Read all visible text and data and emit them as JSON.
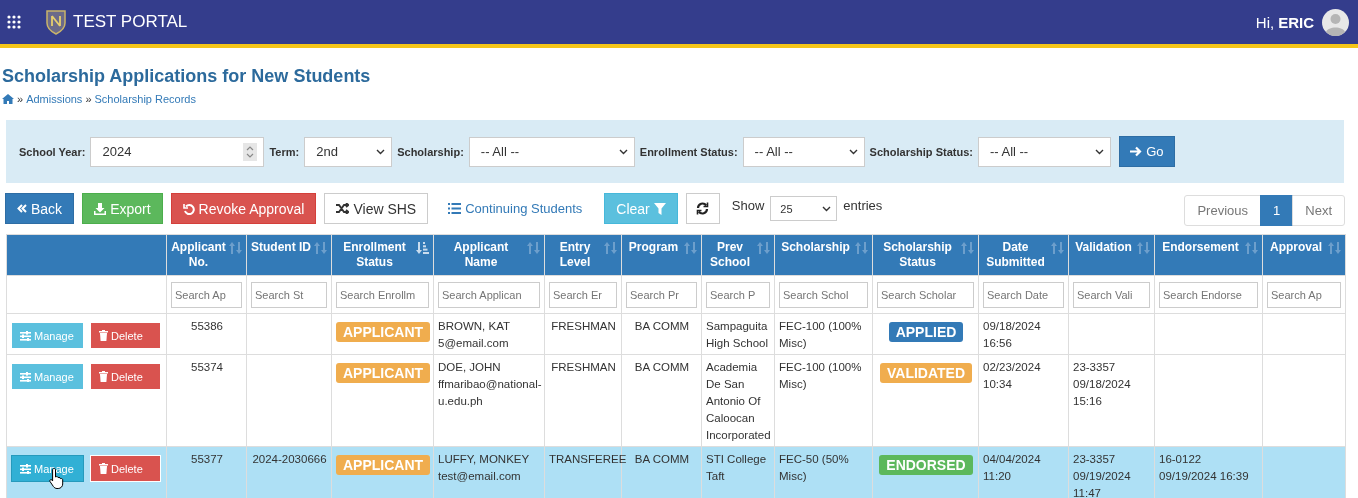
{
  "header": {
    "title": "TEST PORTAL",
    "greeting": "Hi,",
    "user": "ERIC"
  },
  "page": {
    "title": "Scholarship Applications for New Students",
    "breadcrumb": [
      {
        "separator": "»",
        "label": "Admissions"
      },
      {
        "separator": "»",
        "label": "Scholarship Records"
      }
    ]
  },
  "filters": [
    {
      "label": "School Year:",
      "value": "2024",
      "kind": "number"
    },
    {
      "label": "Term:",
      "value": "2nd",
      "kind": "select"
    },
    {
      "label": "Scholarship:",
      "value": "-- All --",
      "kind": "select"
    },
    {
      "label": "Enrollment Status:",
      "value": "-- All --",
      "kind": "select"
    },
    {
      "label": "Scholarship Status:",
      "value": "-- All --",
      "kind": "select"
    }
  ],
  "go_button": "Go",
  "toolbar": [
    {
      "label": "Back",
      "kind": "back"
    },
    {
      "label": "Export",
      "kind": "export"
    },
    {
      "label": "Revoke Approval",
      "kind": "revoke"
    },
    {
      "label": "View SHS",
      "kind": "shs"
    },
    {
      "label": "Continuing Students",
      "kind": "link"
    },
    {
      "label": "Clear",
      "kind": "clear"
    }
  ],
  "show_entries": {
    "label": "Show",
    "value": "25",
    "suffix": "entries"
  },
  "pagination": [
    {
      "label": "Previous",
      "selected": false
    },
    {
      "label": "1",
      "selected": true
    },
    {
      "label": "Next",
      "selected": false
    }
  ],
  "table": {
    "columns": [
      {
        "label": "Applicant No.",
        "placeholder": "Search Ap",
        "sorted": false
      },
      {
        "label": "Student ID",
        "placeholder": "Search St",
        "sorted": false
      },
      {
        "label": "Enrollment Status",
        "placeholder": "Search Enrollm",
        "sorted": true
      },
      {
        "label": "Applicant Name",
        "placeholder": "Search Applican",
        "sorted": false
      },
      {
        "label": "Entry Level",
        "placeholder": "Search Er",
        "sorted": false
      },
      {
        "label": "Program",
        "placeholder": "Search Pr",
        "sorted": false
      },
      {
        "label": "Prev School",
        "placeholder": "Search P",
        "sorted": false
      },
      {
        "label": "Scholarship",
        "placeholder": "Search Schol",
        "sorted": false
      },
      {
        "label": "Scholarship Status",
        "placeholder": "Search Scholar",
        "sorted": false
      },
      {
        "label": "Date Submitted",
        "placeholder": "Search Date",
        "sorted": false
      },
      {
        "label": "Validation",
        "placeholder": "Search Vali",
        "sorted": false
      },
      {
        "label": "Endorsement",
        "placeholder": "Search Endorse",
        "sorted": false
      },
      {
        "label": "Approval",
        "placeholder": "Search Ap",
        "sorted": false
      }
    ],
    "rows": [
      {
        "selected": false,
        "actions": [
          "Manage",
          "Delete"
        ],
        "applicant_no": "55386",
        "student_id": "",
        "enrollment_status": {
          "label": "APPLICANT",
          "color": "#f0ad4e"
        },
        "name": "BROWN, KAT",
        "email": "5@email.com",
        "entry_level": "FRESHMAN",
        "program": "BA COMM",
        "prev_school": "Sampaguita High School",
        "scholarship": "FEC-100 (100% Misc)",
        "scholarship_status": {
          "label": "APPLIED",
          "color": "#337ab7"
        },
        "date_submitted": "09/18/2024 16:56",
        "validation": "",
        "endorsement": "",
        "approval": ""
      },
      {
        "selected": false,
        "actions": [
          "Manage",
          "Delete"
        ],
        "applicant_no": "55374",
        "student_id": "",
        "enrollment_status": {
          "label": "APPLICANT",
          "color": "#f0ad4e"
        },
        "name": "DOE, JOHN",
        "email": "ffmaribao@national-u.edu.ph",
        "entry_level": "FRESHMAN",
        "program": "BA COMM",
        "prev_school": "Academia De San Antonio Of Caloocan Incorporated",
        "scholarship": "FEC-100 (100% Misc)",
        "scholarship_status": {
          "label": "VALIDATED",
          "color": "#f0ad4e"
        },
        "date_submitted": "02/23/2024 10:34",
        "validation": "23-3357 09/18/2024 15:16",
        "endorsement": "",
        "approval": ""
      },
      {
        "selected": true,
        "actions": [
          "Manage",
          "Delete"
        ],
        "applicant_no": "55377",
        "student_id": "2024-2030666",
        "enrollment_status": {
          "label": "APPLICANT",
          "color": "#f0ad4e"
        },
        "name": "LUFFY, MONKEY",
        "email": "test@email.com",
        "entry_level": "TRANSFEREE",
        "program": "BA COMM",
        "prev_school": "STI College Taft",
        "scholarship": "FEC-50 (50% Misc)",
        "scholarship_status": {
          "label": "ENDORSED",
          "color": "#5cb85c"
        },
        "date_submitted": "04/04/2024 11:20",
        "validation": "23-3357 09/19/2024 11:47",
        "endorsement": "16-0122 09/19/2024 16:39",
        "approval": ""
      }
    ]
  }
}
